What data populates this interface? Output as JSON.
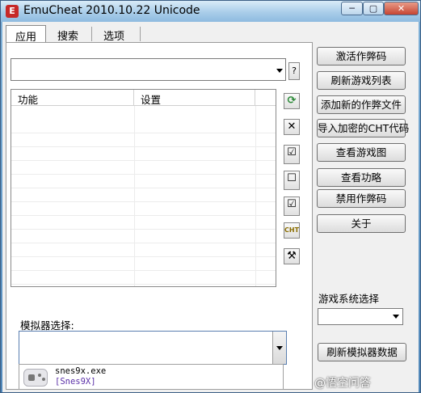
{
  "window": {
    "title": "EmuCheat 2010.10.22 Unicode",
    "app_icon_glyph": "E"
  },
  "caption_buttons": {
    "minimize_glyph": "─",
    "maximize_glyph": "▢",
    "close_glyph": "✕"
  },
  "tabs": [
    {
      "label": "应用",
      "active": true
    },
    {
      "label": "搜索",
      "active": false
    },
    {
      "label": "选项",
      "active": false
    }
  ],
  "game_combo": {
    "value": "",
    "help_label": "?"
  },
  "list": {
    "columns": [
      "功能",
      "设置"
    ],
    "rows": []
  },
  "toolbar_icons": [
    {
      "name": "refresh-icon",
      "glyph": "⟳",
      "color": "#2e8b3a"
    },
    {
      "name": "delete-icon",
      "glyph": "✕",
      "color": "#000000"
    },
    {
      "name": "check-all-icon",
      "glyph": "☑",
      "color": "#000000"
    },
    {
      "name": "uncheck-all-icon",
      "glyph": "☐",
      "color": "#000000"
    },
    {
      "name": "toggle-check-icon",
      "glyph": "☑",
      "color": "#000000"
    },
    {
      "name": "open-cht-folder-icon",
      "glyph": "CHT",
      "color": "#8a6d00"
    },
    {
      "name": "tools-icon",
      "glyph": "⚒",
      "color": "#333333"
    }
  ],
  "actions": [
    {
      "label": "激活作弊码"
    },
    {
      "label": "刷新游戏列表"
    },
    {
      "label": "添加新的作弊文件"
    },
    {
      "label": "导入加密的CHT代码"
    },
    {
      "label": "查看游戏图"
    },
    {
      "label": "查看功略"
    },
    {
      "label": "禁用作弊码"
    },
    {
      "label": "关于"
    }
  ],
  "system_select": {
    "label": "游戏系统选择",
    "value": ""
  },
  "refresh_emulator_label": "刷新模拟器数据",
  "emulator_select": {
    "label": "模拟器选择:",
    "value": "",
    "options": [
      {
        "exe": "snes9x.exe",
        "name": "[Snes9X]"
      }
    ]
  },
  "watermark": "@悟空问答",
  "colors": {
    "accent": "#2e8b3a",
    "option_name": "#5a2fa8"
  }
}
